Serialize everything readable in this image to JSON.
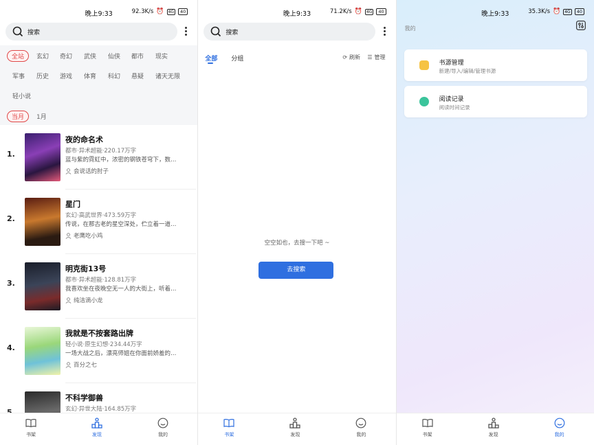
{
  "colors": {
    "accent": "#2f6fe0",
    "tag_red": "#e04848",
    "folder": "#f6c344",
    "history": "#3bc49b"
  },
  "panels": [
    {
      "status": {
        "time": "晚上9:33",
        "speed": "92.3K/s",
        "net": "4G",
        "battery": "40"
      },
      "search_label": "搜索",
      "categories": [
        "全站",
        "玄幻",
        "奇幻",
        "武侠",
        "仙侠",
        "都市",
        "现实",
        "军事",
        "历史",
        "游戏",
        "体育",
        "科幻",
        "悬疑",
        "诸天无限",
        "轻小说"
      ],
      "periods": [
        "当月",
        "1月"
      ],
      "books": [
        {
          "rank": "1.",
          "title": "夜的命名术",
          "meta": "都市·异术超能·220.17万字",
          "desc": "蓝与紫的霓虹中，浓密的钢铁苍穹下，数…",
          "author": "会说话的肘子"
        },
        {
          "rank": "2.",
          "title": "星门",
          "meta": "玄幻·高武世界·473.59万字",
          "desc": "传说，在那古老的星空深处，伫立着一道…",
          "author": "老鹰吃小鸡"
        },
        {
          "rank": "3.",
          "title": "明克街13号",
          "meta": "都市·异术超能·128.81万字",
          "desc": "我喜欢坐在夜晚空无一人的大街上，听着…",
          "author": "纯洁滴小龙"
        },
        {
          "rank": "4.",
          "title": "我就是不按套路出牌",
          "meta": "轻小说·原生幻想·234.44万字",
          "desc": "一场大战之后，漂亮师姐在你面前娇羞的…",
          "author": "百分之七"
        },
        {
          "rank": "5.",
          "title": "不科学御兽",
          "meta": "玄幻·异世大陆·164.85万字",
          "desc": "",
          "author": ""
        }
      ],
      "nav": [
        "书架",
        "发现",
        "我的"
      ],
      "nav_active": 1
    },
    {
      "status": {
        "time": "晚上9:33",
        "speed": "71.2K/s",
        "net": "4G",
        "battery": "40"
      },
      "search_label": "搜索",
      "tabs": [
        "全部",
        "分组"
      ],
      "tools": {
        "refresh": "刷新",
        "manage": "管理"
      },
      "empty_text": "空空如也，去搜一下吧 ~",
      "go_search": "去搜索",
      "nav": [
        "书架",
        "发现",
        "我的"
      ],
      "nav_active": 0
    },
    {
      "status": {
        "time": "晚上9:33",
        "speed": "35.3K/s",
        "net": "4G",
        "battery": "40"
      },
      "my_label": "我的",
      "cards": [
        {
          "title": "书源管理",
          "subtitle": "新建/导入/编辑/管理书源",
          "icon": "folder-icon"
        },
        {
          "title": "阅读记录",
          "subtitle": "阅读时间记录",
          "icon": "clock-icon"
        }
      ],
      "nav": [
        "书架",
        "发现",
        "我的"
      ],
      "nav_active": 2
    }
  ]
}
